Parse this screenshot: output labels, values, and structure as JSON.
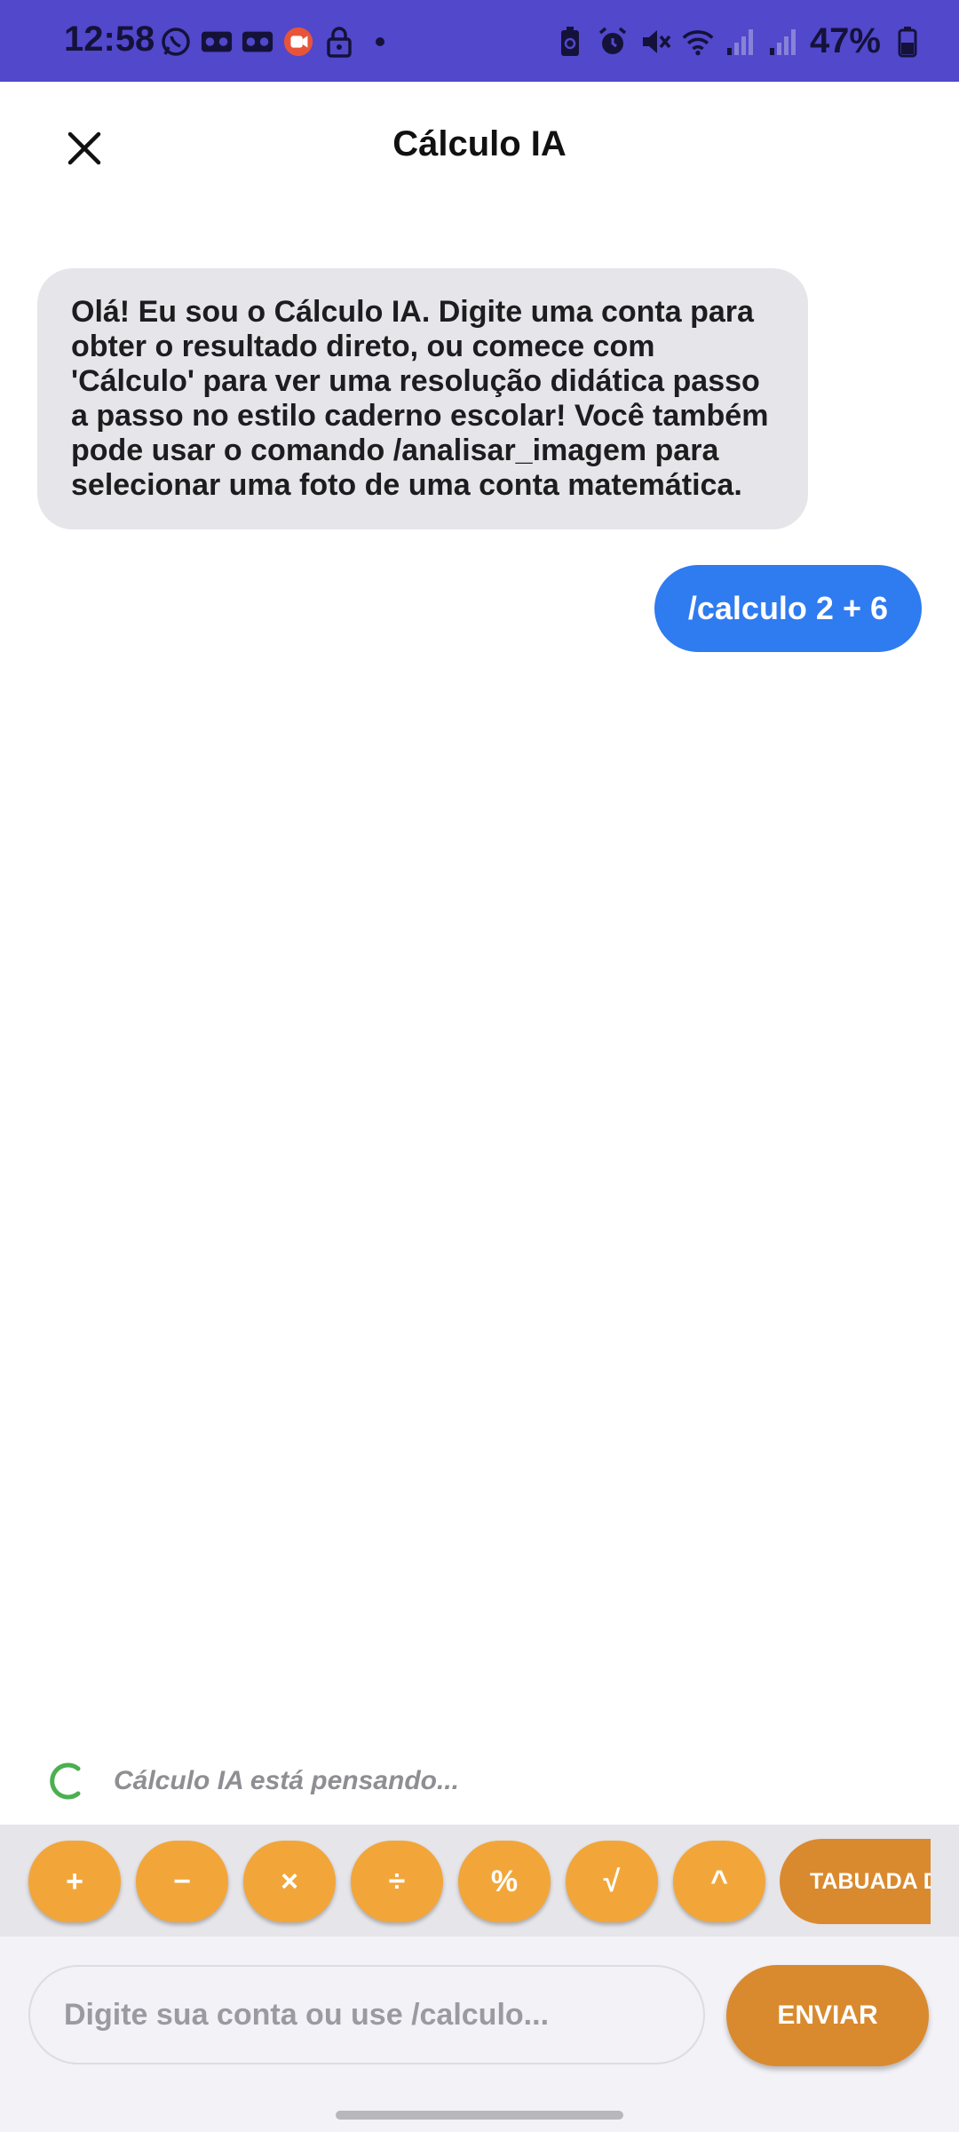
{
  "status_bar": {
    "time": "12:58",
    "battery": "47%",
    "left_icons": [
      "whatsapp-icon",
      "voicemail-icon",
      "voicemail-icon",
      "screen-recorder-icon",
      "lock-icon",
      "dot-icon"
    ],
    "right_icons": [
      "battery-saver-icon",
      "alarm-icon",
      "mute-icon",
      "wifi-icon",
      "signal-icon",
      "signal-icon",
      "battery-icon"
    ]
  },
  "header": {
    "title": "Cálculo IA",
    "close_icon": "close-icon"
  },
  "messages": [
    {
      "sender": "bot",
      "text": "Olá! Eu sou o Cálculo IA. Digite uma conta para obter o resultado direto, ou comece com 'Cálculo' para ver uma resolução didática passo a passo no estilo caderno escolar! Você também pode usar o comando /analisar_imagem para selecionar uma foto de uma conta matemática."
    },
    {
      "sender": "user",
      "text": "/calculo 2 + 6"
    }
  ],
  "thinking": {
    "text": "Cálculo IA está pensando..."
  },
  "operators": [
    "+",
    "−",
    "×",
    "÷",
    "%",
    "√",
    "^"
  ],
  "tabuada_label": "TABUADA DE",
  "input": {
    "placeholder": "Digite sua conta ou use /calculo...",
    "value": ""
  },
  "send_label": "ENVIAR",
  "colors": {
    "status_bar": "#5148cc",
    "user_bubble": "#2f7bf0",
    "bot_bubble": "#e5e5ea",
    "operator_button": "#f2a63a",
    "send_button": "#d98a2e",
    "spinner": "#4caf50"
  }
}
